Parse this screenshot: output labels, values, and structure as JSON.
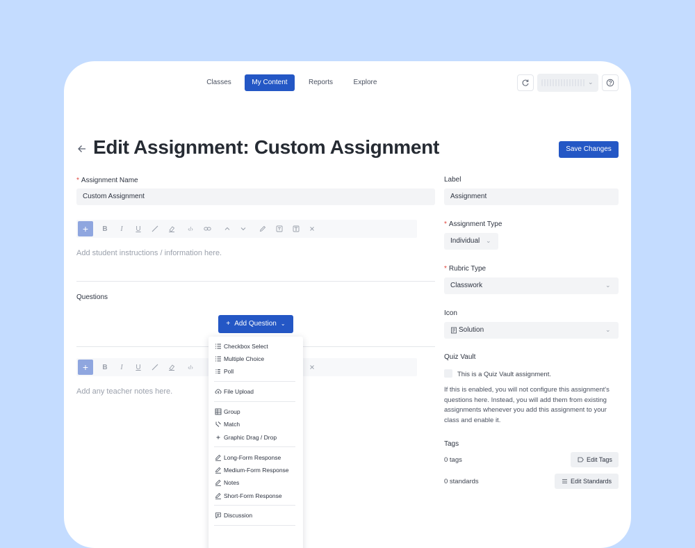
{
  "nav": {
    "tabs": [
      {
        "label": "Classes",
        "active": false
      },
      {
        "label": "My Content",
        "active": true
      },
      {
        "label": "Reports",
        "active": false
      },
      {
        "label": "Explore",
        "active": false
      }
    ]
  },
  "header": {
    "title": "Edit Assignment: Custom Assignment",
    "save_label": "Save Changes"
  },
  "form": {
    "assignment_name_label": "Assignment Name",
    "assignment_name_value": "Custom Assignment",
    "instructions_placeholder": "Add student instructions / information here.",
    "questions_label": "Questions",
    "add_question_label": "Add Question",
    "teacher_notes_placeholder": "Add any teacher notes here."
  },
  "question_menu": {
    "groups": [
      [
        "Checkbox Select",
        "Multiple Choice",
        "Poll"
      ],
      [
        "File Upload"
      ],
      [
        "Group",
        "Match",
        "Graphic Drag / Drop"
      ],
      [
        "Long-Form Response",
        "Medium-Form Response",
        "Notes",
        "Short-Form Response"
      ],
      [
        "Discussion"
      ]
    ]
  },
  "sidebar": {
    "label_label": "Label",
    "label_value": "Assignment",
    "assignment_type_label": "Assignment Type",
    "assignment_type_value": "Individual",
    "rubric_type_label": "Rubric Type",
    "rubric_type_value": "Classwork",
    "icon_label": "Icon",
    "icon_value": "Solution",
    "quiz_vault_label": "Quiz Vault",
    "quiz_vault_checkbox_label": "This is a Quiz Vault assignment.",
    "quiz_vault_checked": false,
    "quiz_vault_description": "If this is enabled, you will not configure this assignment's questions here. Instead, you will add them from existing assignments whenever you add this assignment to your class and enable it.",
    "tags_label": "Tags",
    "tags_count": "0 tags",
    "edit_tags_label": "Edit Tags",
    "standards_count": "0 standards",
    "edit_standards_label": "Edit Standards"
  },
  "colors": {
    "background": "#c4dcff",
    "primary": "#2457c5",
    "required": "#e0443c"
  }
}
